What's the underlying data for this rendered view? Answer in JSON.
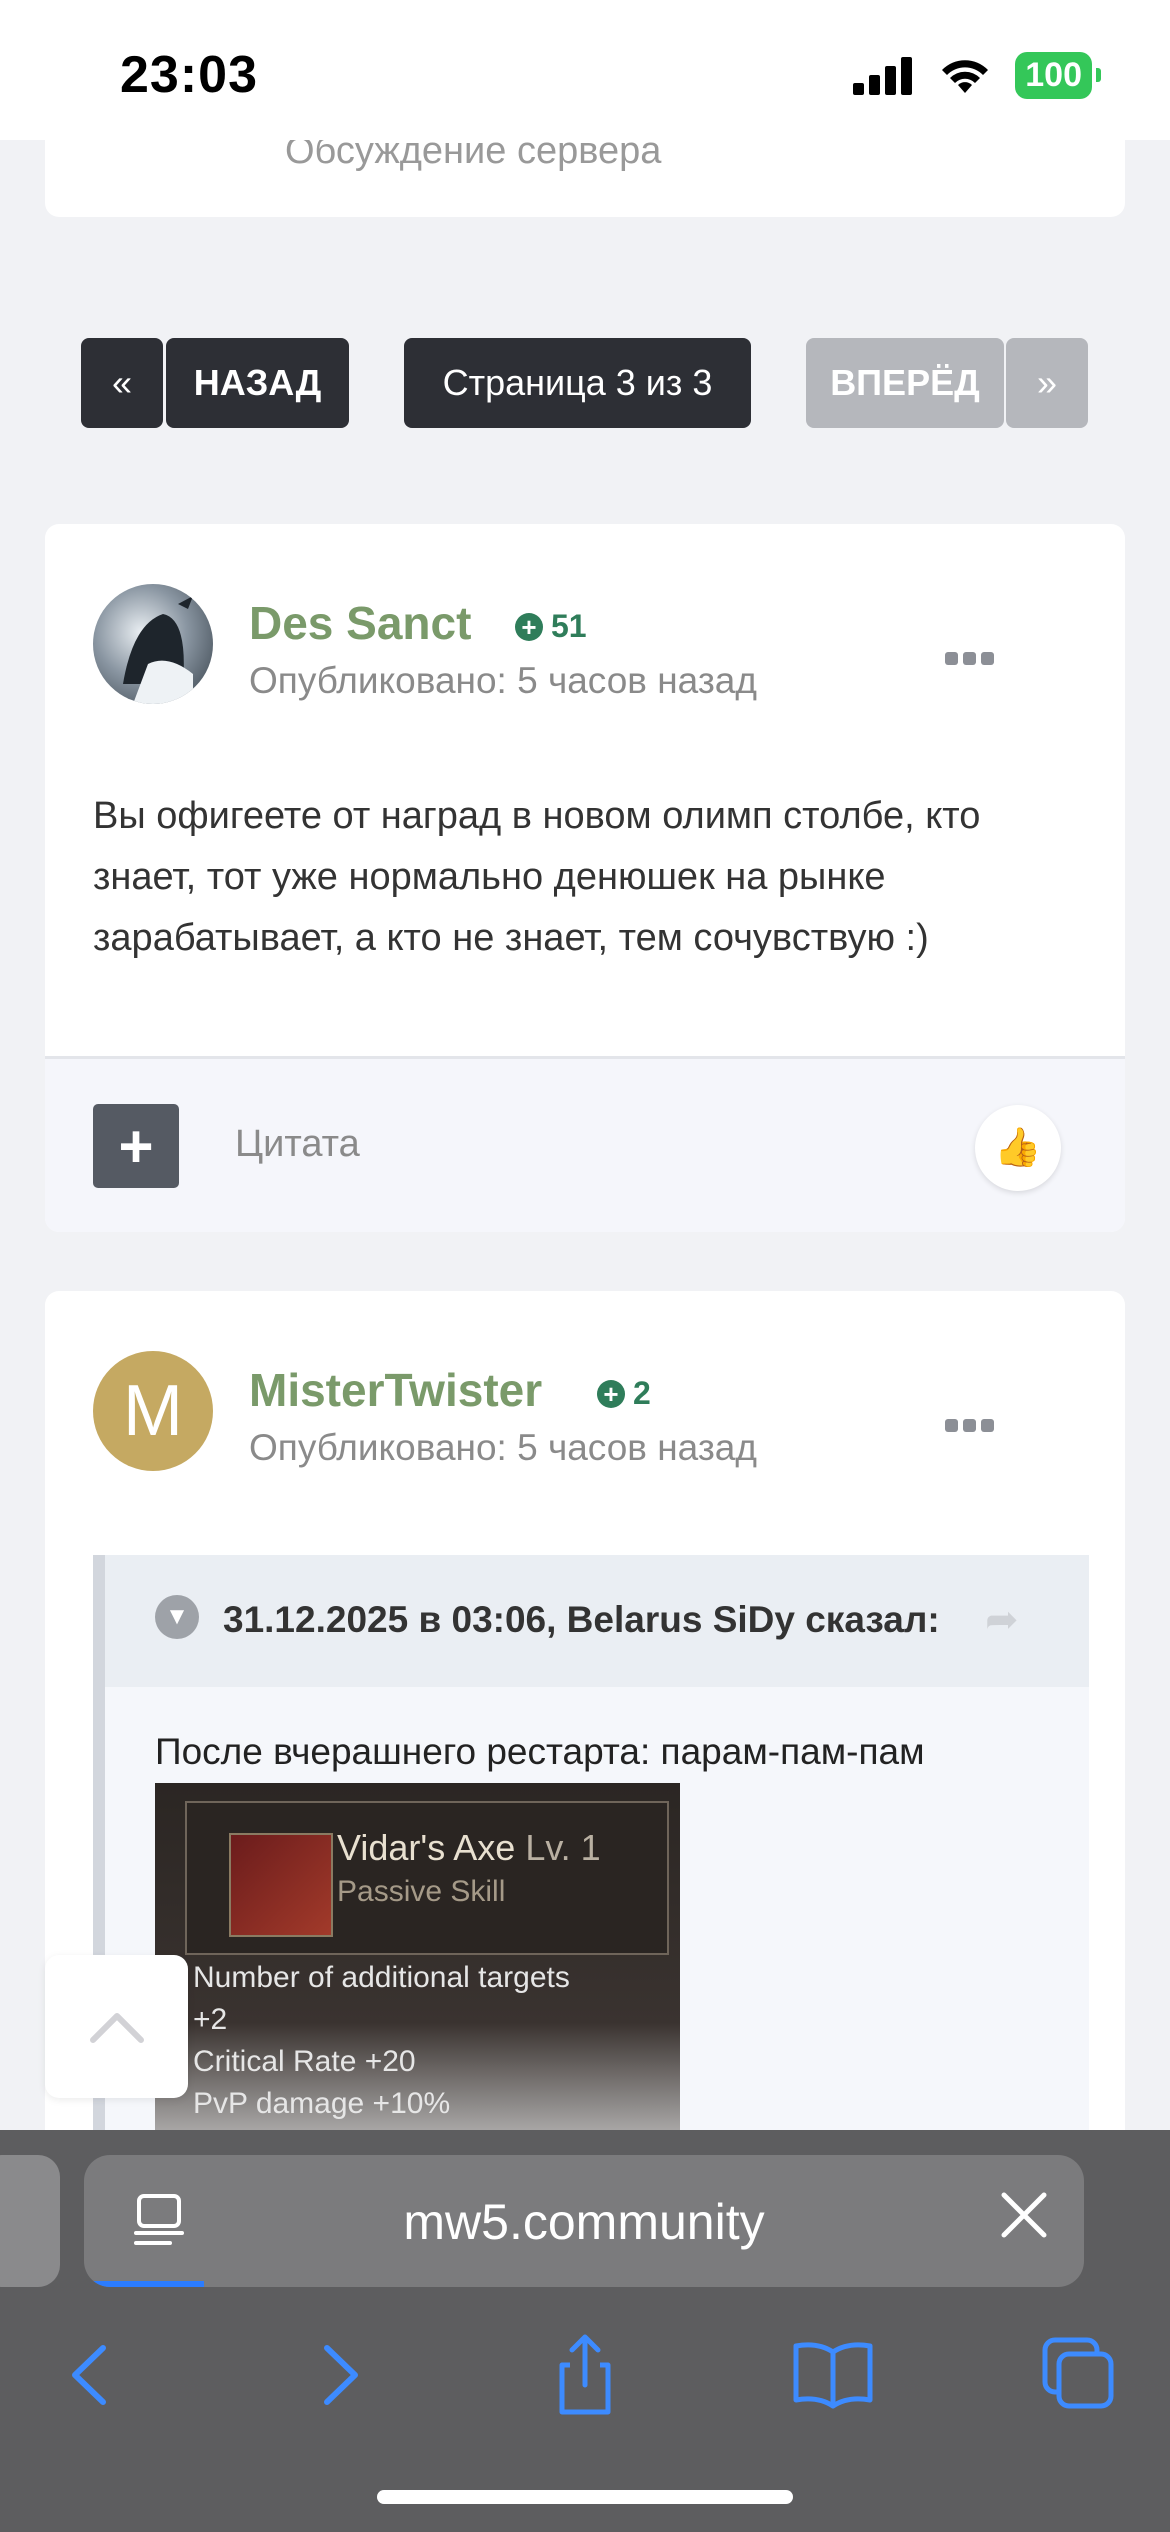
{
  "status": {
    "time": "23:03",
    "battery": "100"
  },
  "top_card": {
    "subtitle": "Обсуждение сервера"
  },
  "pagination": {
    "prev_icon": "«",
    "prev": "НАЗАД",
    "page": "Страница 3 из 3",
    "next": "ВПЕРЁД",
    "next_icon": "»"
  },
  "posts": [
    {
      "author": "Des Sanct",
      "reputation": "51",
      "posted": "Опубликовано: 5 часов назад",
      "text": "Вы офигеете от наград в новом олимп столбе, кто знает, тот уже нормально денюшек на рынке зарабатывает, а кто не знает, тем сочувствую :)",
      "quote_label": "Цитата",
      "like_icon": "👍"
    },
    {
      "author": "MisterTwister",
      "avatar_letter": "M",
      "reputation": "2",
      "posted": "Опубликовано: 5 часов назад",
      "quote": {
        "cite": "31.12.2025 в 03:06, Belarus SiDy сказал:",
        "text": "После вчерашнего рестарта: парам-пам-пам",
        "image": {
          "title": "Vidar's Axe",
          "level": "Lv. 1",
          "subtitle": "Passive Skill",
          "lines": [
            "Number of additional targets",
            "+2",
            "Critical Rate +20",
            "PvP damage +10%"
          ]
        }
      }
    }
  ],
  "browser": {
    "url": "mw5.community"
  },
  "colors": {
    "author": "#7a9a6a",
    "reputation": "#2f7d5a",
    "button_dark": "#2d2f35",
    "button_disabled": "#b5b7bc",
    "browser_blue": "#2b7cff"
  }
}
